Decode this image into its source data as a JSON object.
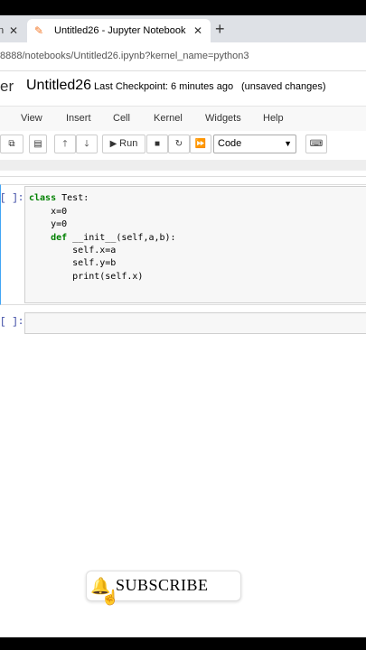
{
  "browser": {
    "prev_tab_fragment": "n",
    "active_tab_title": "Untitled26 - Jupyter Notebook",
    "url": "8888/notebooks/Untitled26.ipynb?kernel_name=python3"
  },
  "jupyter": {
    "logo_fragment": "er",
    "notebook_name": "Untitled26",
    "checkpoint": "Last Checkpoint: 6 minutes ago",
    "status": "(unsaved changes)",
    "menu": [
      "View",
      "Insert",
      "Cell",
      "Kernel",
      "Widgets",
      "Help"
    ],
    "toolbar": {
      "run_label": "Run",
      "cell_type": "Code"
    }
  },
  "cells": [
    {
      "prompt": "]:",
      "lines": [
        "class Test:",
        "    x=0",
        "    y=0",
        "    def __init__(self,a,b):",
        "        self.x=a",
        "        self.y=b",
        "        print(self.x)"
      ]
    },
    {
      "prompt": "]:",
      "lines": []
    }
  ],
  "overlay": {
    "subscribe_label": "SUBSCRIBE"
  },
  "colors": {
    "tab_strip": "#dee1e6",
    "jupyter_orange": "#f37726",
    "keyword_green": "#008000",
    "selected_cell": "#42a5f5",
    "subscribe_red": "#e53935"
  }
}
